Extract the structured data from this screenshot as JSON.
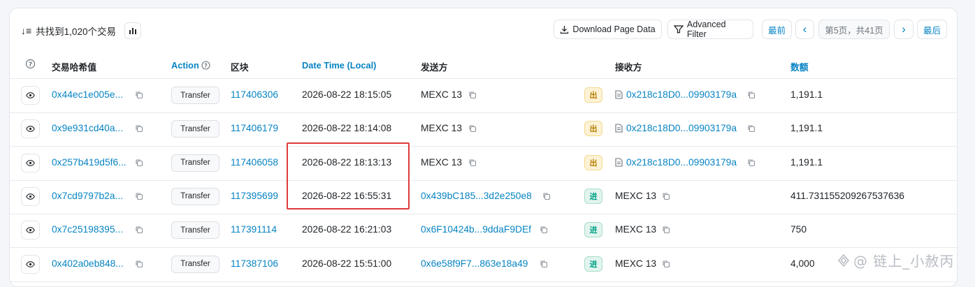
{
  "summary": {
    "sort_icon": "↓≡",
    "text": "共找到1,020个交易"
  },
  "toolbar": {
    "download_label": "Download Page Data",
    "filter_label": "Advanced Filter",
    "first_label": "最前",
    "prev_label": "‹",
    "page_label": "第5页，共41页",
    "next_label": "›",
    "last_label": "最后"
  },
  "columns": {
    "hash": "交易哈希值",
    "action": "Action",
    "block": "区块",
    "datetime": "Date Time (Local)",
    "from": "发送方",
    "to": "接收方",
    "amount": "数额"
  },
  "rows": [
    {
      "hash": "0x44ec1e005e...",
      "method": "Transfer",
      "block": "117406306",
      "time": "2026-08-22 18:15:05",
      "from": "MEXC 13",
      "dir": "出",
      "to": "0x218c18D0...09903179a",
      "amount": "1,191.1"
    },
    {
      "hash": "0x9e931cd40a...",
      "method": "Transfer",
      "block": "117406179",
      "time": "2026-08-22 18:14:08",
      "from": "MEXC 13",
      "dir": "出",
      "to": "0x218c18D0...09903179a",
      "amount": "1,191.1"
    },
    {
      "hash": "0x257b419d5f6...",
      "method": "Transfer",
      "block": "117406058",
      "time": "2026-08-22 18:13:13",
      "from": "MEXC 13",
      "dir": "出",
      "to": "0x218c18D0...09903179a",
      "amount": "1,191.1"
    },
    {
      "hash": "0x7cd9797b2a...",
      "method": "Transfer",
      "block": "117395699",
      "time": "2026-08-22 16:55:31",
      "from": "0x439bC185...3d2e250e8",
      "dir": "进",
      "to": "MEXC 13",
      "amount": "411.731155209267537636"
    },
    {
      "hash": "0x7c25198395...",
      "method": "Transfer",
      "block": "117391114",
      "time": "2026-08-22 16:21:03",
      "from": "0x6F10424b...9ddaF9DEf",
      "dir": "进",
      "to": "MEXC 13",
      "amount": "750"
    },
    {
      "hash": "0x402a0eb848...",
      "method": "Transfer",
      "block": "117387106",
      "time": "2026-08-22 15:51:00",
      "from": "0x6e58f9F7...863e18a49",
      "dir": "进",
      "to": "MEXC 13",
      "amount": "4,000"
    }
  ],
  "watermark": "@ 链上_小赦丙",
  "colors": {
    "link": "#0784c3",
    "highlight": "#e03b3b",
    "out_badge": "#fdf2d5",
    "in_badge": "#e3f4ee"
  }
}
